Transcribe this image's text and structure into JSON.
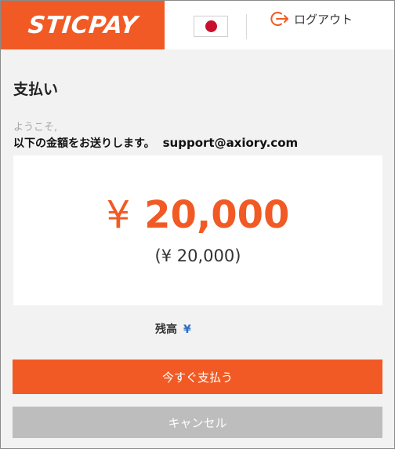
{
  "header": {
    "logo_text": "STICPAY",
    "flag": "japan-flag-icon",
    "logout_label": "ログアウト",
    "logout_icon": "logout-icon"
  },
  "payment": {
    "title": "支払い",
    "welcome": "ようこそ,",
    "message": "以下の金額をお送りします。",
    "recipient_email": "support@axiory.com",
    "currency_symbol": "¥",
    "amount": "20,000",
    "converted_amount": "(¥ 20,000)",
    "balance_label": "残高",
    "balance_currency": "¥"
  },
  "actions": {
    "pay_label": "今すぐ支払う",
    "cancel_label": "キャンセル"
  },
  "colors": {
    "brand": "#f15a24",
    "cancel": "#bdbdbd",
    "balance_currency": "#2a6fc9"
  }
}
